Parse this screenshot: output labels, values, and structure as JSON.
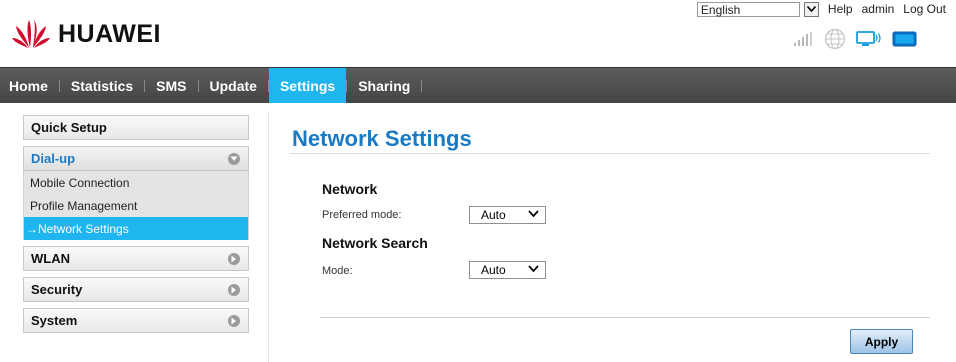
{
  "header": {
    "brand": "HUAWEI",
    "brand_color": "#cf0a2c",
    "language": "English",
    "links": {
      "help": "Help",
      "user": "admin",
      "logout": "Log Out"
    },
    "status_icons": [
      "signal-strength-icon",
      "globe-icon",
      "wifi-monitor-icon",
      "battery-icon"
    ]
  },
  "nav": {
    "items": [
      "Home",
      "Statistics",
      "SMS",
      "Update",
      "Settings",
      "Sharing"
    ],
    "active": "Settings",
    "active_color": "#1fb6ef"
  },
  "sidebar": {
    "quick_setup": "Quick Setup",
    "dialup": "Dial-up",
    "dialup_items": [
      "Mobile Connection",
      "Profile Management",
      "→Network Settings"
    ],
    "wlan": "WLAN",
    "security": "Security",
    "system": "System"
  },
  "main": {
    "title": "Network Settings",
    "network": {
      "heading": "Network",
      "label": "Preferred mode:",
      "value": "Auto"
    },
    "search": {
      "heading": "Network Search",
      "label": "Mode:",
      "value": "Auto"
    },
    "apply": "Apply"
  }
}
